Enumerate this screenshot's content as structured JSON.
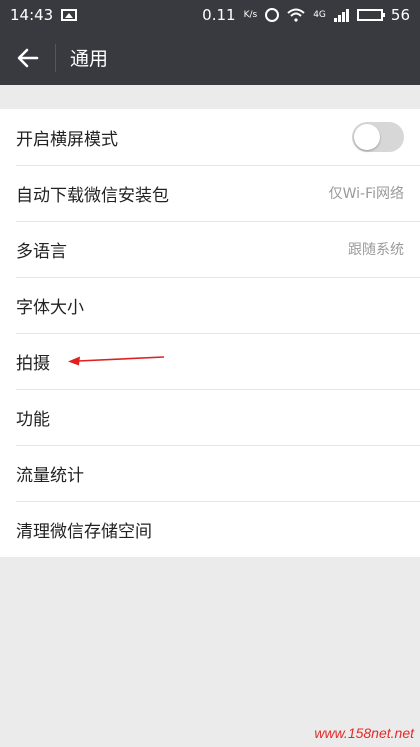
{
  "status": {
    "time": "14:43",
    "speed": "0.11",
    "speed_unit": "K/s",
    "network": "4G",
    "battery": "56"
  },
  "header": {
    "title": "通用"
  },
  "settings": {
    "items": [
      {
        "label": "开启横屏模式",
        "value": "",
        "toggle": false
      },
      {
        "label": "自动下载微信安装包",
        "value": "仅Wi-Fi网络"
      },
      {
        "label": "多语言",
        "value": "跟随系统"
      },
      {
        "label": "字体大小",
        "value": ""
      },
      {
        "label": "拍摄",
        "value": ""
      },
      {
        "label": "功能",
        "value": ""
      },
      {
        "label": "流量统计",
        "value": ""
      },
      {
        "label": "清理微信存储空间",
        "value": ""
      }
    ]
  },
  "watermark": "www.158net.net",
  "colors": {
    "header_bg": "#393a3f",
    "annotation_arrow": "#e02020"
  }
}
